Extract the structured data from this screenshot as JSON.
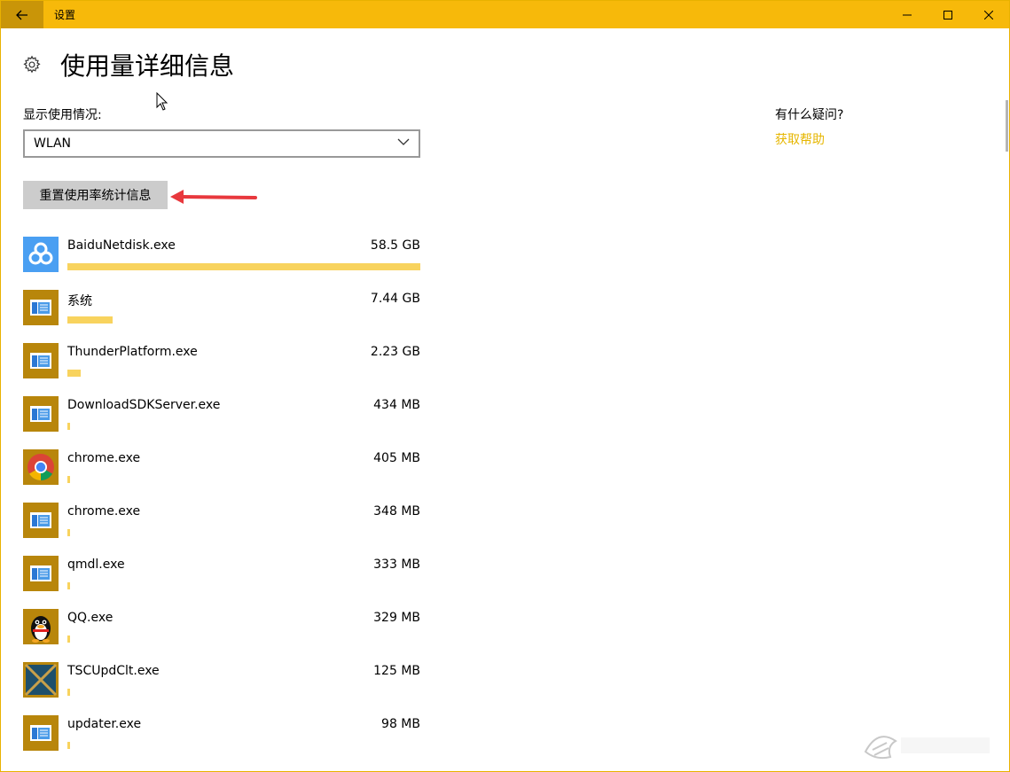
{
  "titlebar": {
    "title": "设置"
  },
  "header": {
    "title": "使用量详细信息"
  },
  "usage": {
    "show_label": "显示使用情况:",
    "network": "WLAN",
    "reset_label": "重置使用率统计信息"
  },
  "help": {
    "question": "有什么疑问?",
    "link": "获取帮助"
  },
  "colors": {
    "accent": "#f7b90a",
    "bar": "#f8d35e",
    "link": "#e6b600",
    "icon_bg": "#b8860b"
  },
  "apps": [
    {
      "name": "BaiduNetdisk.exe",
      "size": "58.5 GB",
      "usage_ratio": 1.0,
      "icon": "baidu-netdisk-icon"
    },
    {
      "name": "系统",
      "size": "7.44 GB",
      "usage_ratio": 0.128,
      "icon": "app-window-icon"
    },
    {
      "name": "ThunderPlatform.exe",
      "size": "2.23 GB",
      "usage_ratio": 0.038,
      "icon": "app-window-icon"
    },
    {
      "name": "DownloadSDKServer.exe",
      "size": "434 MB",
      "usage_ratio": 0.0073,
      "icon": "app-window-icon"
    },
    {
      "name": "chrome.exe",
      "size": "405 MB",
      "usage_ratio": 0.0068,
      "icon": "chrome-icon"
    },
    {
      "name": "chrome.exe",
      "size": "348 MB",
      "usage_ratio": 0.0059,
      "icon": "app-window-icon"
    },
    {
      "name": "qmdl.exe",
      "size": "333 MB",
      "usage_ratio": 0.0056,
      "icon": "app-window-icon"
    },
    {
      "name": "QQ.exe",
      "size": "329 MB",
      "usage_ratio": 0.0055,
      "icon": "qq-penguin-icon"
    },
    {
      "name": "TSCUpdClt.exe",
      "size": "125 MB",
      "usage_ratio": 0.0021,
      "icon": "tsc-update-icon"
    },
    {
      "name": "updater.exe",
      "size": "98 MB",
      "usage_ratio": 0.0017,
      "icon": "app-window-icon"
    }
  ]
}
